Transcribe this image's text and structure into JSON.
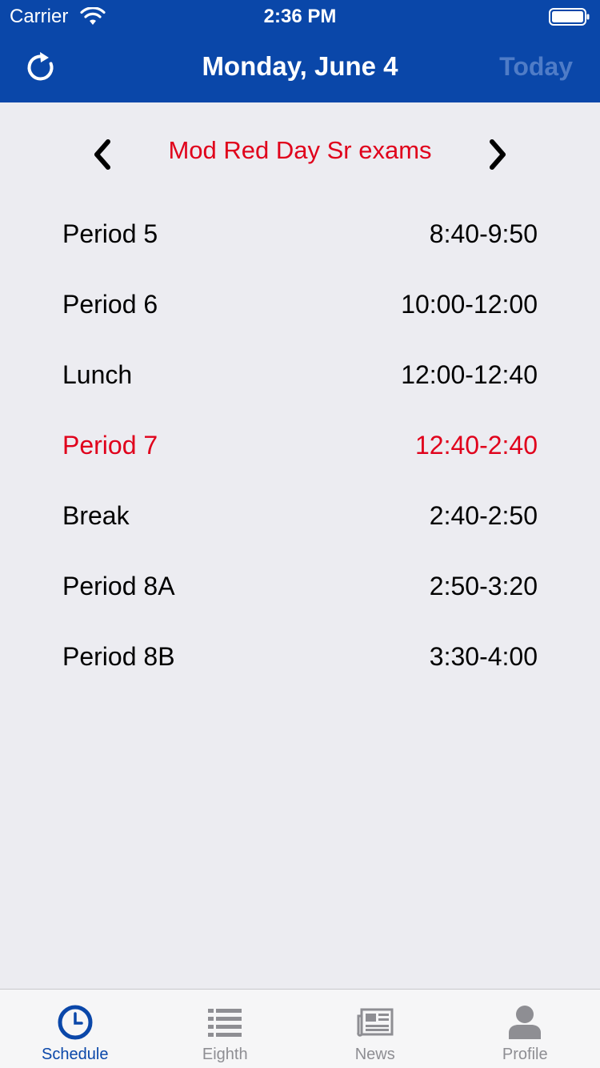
{
  "status_bar": {
    "carrier": "Carrier",
    "time": "2:36 PM"
  },
  "nav": {
    "title": "Monday, June 4",
    "today_label": "Today",
    "refresh_icon": "refresh-icon"
  },
  "day": {
    "type": "Mod Red Day Sr exams",
    "prev_icon": "chevron-left-icon",
    "next_icon": "chevron-right-icon"
  },
  "schedule": [
    {
      "name": "Period 5",
      "time": "8:40-9:50",
      "current": false
    },
    {
      "name": "Period 6",
      "time": "10:00-12:00",
      "current": false
    },
    {
      "name": "Lunch",
      "time": "12:00-12:40",
      "current": false
    },
    {
      "name": "Period 7",
      "time": "12:40-2:40",
      "current": true
    },
    {
      "name": "Break",
      "time": "2:40-2:50",
      "current": false
    },
    {
      "name": "Period 8A",
      "time": "2:50-3:20",
      "current": false
    },
    {
      "name": "Period 8B",
      "time": "3:30-4:00",
      "current": false
    }
  ],
  "tabs": [
    {
      "label": "Schedule",
      "icon": "clock-icon",
      "active": true
    },
    {
      "label": "Eighth",
      "icon": "list-icon",
      "active": false
    },
    {
      "label": "News",
      "icon": "newspaper-icon",
      "active": false
    },
    {
      "label": "Profile",
      "icon": "person-icon",
      "active": false
    }
  ],
  "colors": {
    "header": "#0a47a9",
    "accent_red": "#e0001b",
    "background": "#ececf1",
    "today_inactive": "#4f7cc7"
  }
}
